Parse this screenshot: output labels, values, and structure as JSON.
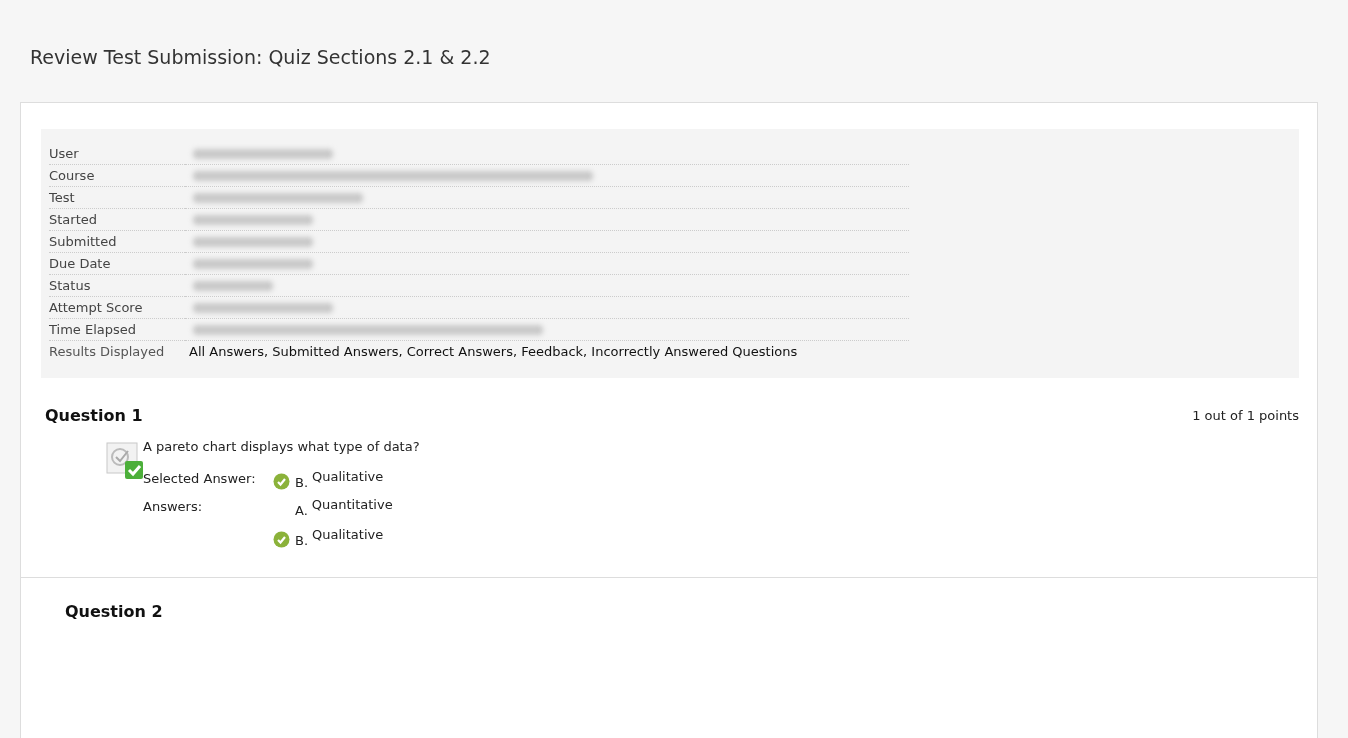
{
  "page_title": "Review Test Submission: Quiz Sections 2.1 & 2.2",
  "details": [
    {
      "label": "User",
      "redacted": true
    },
    {
      "label": "Course",
      "redacted": true
    },
    {
      "label": "Test",
      "redacted": true
    },
    {
      "label": "Started",
      "redacted": true
    },
    {
      "label": "Submitted",
      "redacted": true
    },
    {
      "label": "Due Date",
      "redacted": true
    },
    {
      "label": "Status",
      "redacted": true
    },
    {
      "label": "Attempt Score",
      "redacted": true
    },
    {
      "label": "Time Elapsed",
      "redacted": true
    },
    {
      "label": "Results Displayed",
      "value": "All Answers, Submitted Answers, Correct Answers, Feedback, Incorrectly Answered Questions",
      "redacted": false
    }
  ],
  "questions": [
    {
      "title": "Question 1",
      "points": "1 out of 1 points",
      "correct": true,
      "text": "A pareto chart displays what type of data?",
      "answer_groups": [
        {
          "label": "Selected Answer:",
          "answers": [
            {
              "letter": "B.",
              "text": "Qualitative",
              "correct": true
            }
          ]
        },
        {
          "label": "Answers:",
          "answers": [
            {
              "letter": "A.",
              "text": "Quantitative",
              "correct": false
            },
            {
              "letter": "B.",
              "text": "Qualitative",
              "correct": true
            }
          ]
        }
      ]
    }
  ],
  "next_question": {
    "title": "Question 2"
  }
}
